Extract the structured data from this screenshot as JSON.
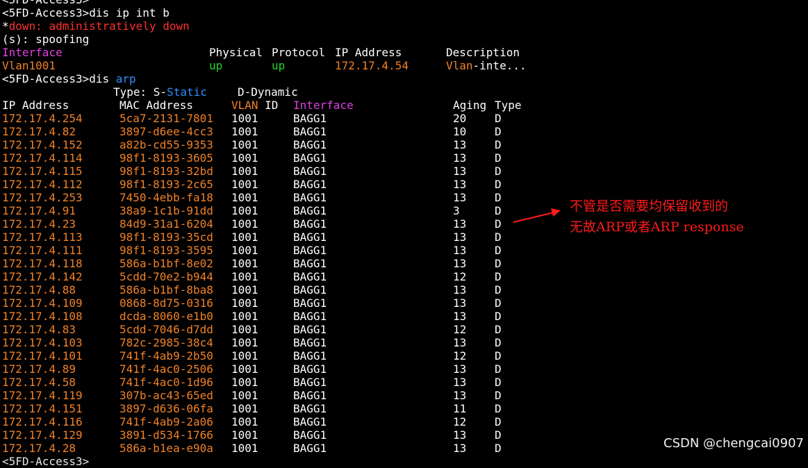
{
  "terminal": {
    "lines_top": [
      "<5FD-Access3>",
      "<5FD-Access3>dis ip int b"
    ],
    "down_star": "*",
    "down_word": "down",
    "down_rest": ": administratively down",
    "spoofing_line": "(s): spoofing",
    "ipint_header": {
      "interface": "Interface",
      "physical": "Physical",
      "protocol": "Protocol",
      "ip": "IP Address",
      "desc": "Description"
    },
    "ipint_row": {
      "interface": "Vlan1001",
      "physical": "up",
      "protocol": "up",
      "ip": "172.17.4.54",
      "desc_vlan": "Vlan",
      "desc_rest": "-inte..."
    },
    "arp_cmd_prefix": "<5FD-Access3>dis ",
    "arp_cmd_word": "arp",
    "type_label": "Type: ",
    "type_s_prefix": "S-",
    "type_s_word": "Static",
    "type_d": "D-Dynamic",
    "arp_header": {
      "ip": "IP Address",
      "mac": "MAC Address",
      "vlan_word": "VLAN",
      "vlan_id": " ID",
      "interface": "Interface",
      "aging": "Aging",
      "type": "Type"
    },
    "arp_rows": [
      {
        "ip": "172.17.4.254",
        "mac": "5ca7-2131-7801",
        "vlan": "1001",
        "iface": "BAGG1",
        "aging": "20",
        "type": "D"
      },
      {
        "ip": "172.17.4.82",
        "mac": "3897-d6ee-4cc3",
        "vlan": "1001",
        "iface": "BAGG1",
        "aging": "10",
        "type": "D"
      },
      {
        "ip": "172.17.4.152",
        "mac": "a82b-cd55-9353",
        "vlan": "1001",
        "iface": "BAGG1",
        "aging": "13",
        "type": "D"
      },
      {
        "ip": "172.17.4.114",
        "mac": "98f1-8193-3605",
        "vlan": "1001",
        "iface": "BAGG1",
        "aging": "13",
        "type": "D"
      },
      {
        "ip": "172.17.4.115",
        "mac": "98f1-8193-32bd",
        "vlan": "1001",
        "iface": "BAGG1",
        "aging": "13",
        "type": "D"
      },
      {
        "ip": "172.17.4.112",
        "mac": "98f1-8193-2c65",
        "vlan": "1001",
        "iface": "BAGG1",
        "aging": "13",
        "type": "D"
      },
      {
        "ip": "172.17.4.253",
        "mac": "7450-4ebb-fa18",
        "vlan": "1001",
        "iface": "BAGG1",
        "aging": "13",
        "type": "D"
      },
      {
        "ip": "172.17.4.91",
        "mac": "38a9-1c1b-91dd",
        "vlan": "1001",
        "iface": "BAGG1",
        "aging": "3",
        "type": "D"
      },
      {
        "ip": "172.17.4.23",
        "mac": "84d9-31a1-6204",
        "vlan": "1001",
        "iface": "BAGG1",
        "aging": "13",
        "type": "D"
      },
      {
        "ip": "172.17.4.113",
        "mac": "98f1-8193-35cd",
        "vlan": "1001",
        "iface": "BAGG1",
        "aging": "13",
        "type": "D"
      },
      {
        "ip": "172.17.4.111",
        "mac": "98f1-8193-3595",
        "vlan": "1001",
        "iface": "BAGG1",
        "aging": "13",
        "type": "D"
      },
      {
        "ip": "172.17.4.118",
        "mac": "586a-b1bf-8e02",
        "vlan": "1001",
        "iface": "BAGG1",
        "aging": "13",
        "type": "D"
      },
      {
        "ip": "172.17.4.142",
        "mac": "5cdd-70e2-b944",
        "vlan": "1001",
        "iface": "BAGG1",
        "aging": "12",
        "type": "D"
      },
      {
        "ip": "172.17.4.88",
        "mac": "586a-b1bf-8ba8",
        "vlan": "1001",
        "iface": "BAGG1",
        "aging": "13",
        "type": "D"
      },
      {
        "ip": "172.17.4.109",
        "mac": "0868-8d75-0316",
        "vlan": "1001",
        "iface": "BAGG1",
        "aging": "13",
        "type": "D"
      },
      {
        "ip": "172.17.4.108",
        "mac": "dcda-8060-e1b0",
        "vlan": "1001",
        "iface": "BAGG1",
        "aging": "13",
        "type": "D"
      },
      {
        "ip": "172.17.4.83",
        "mac": "5cdd-7046-d7dd",
        "vlan": "1001",
        "iface": "BAGG1",
        "aging": "12",
        "type": "D"
      },
      {
        "ip": "172.17.4.103",
        "mac": "782c-2985-38c4",
        "vlan": "1001",
        "iface": "BAGG1",
        "aging": "13",
        "type": "D"
      },
      {
        "ip": "172.17.4.101",
        "mac": "741f-4ab9-2b50",
        "vlan": "1001",
        "iface": "BAGG1",
        "aging": "12",
        "type": "D"
      },
      {
        "ip": "172.17.4.89",
        "mac": "741f-4ac0-2506",
        "vlan": "1001",
        "iface": "BAGG1",
        "aging": "13",
        "type": "D"
      },
      {
        "ip": "172.17.4.58",
        "mac": "741f-4ac0-1d96",
        "vlan": "1001",
        "iface": "BAGG1",
        "aging": "13",
        "type": "D"
      },
      {
        "ip": "172.17.4.119",
        "mac": "307b-ac43-65ed",
        "vlan": "1001",
        "iface": "BAGG1",
        "aging": "13",
        "type": "D"
      },
      {
        "ip": "172.17.4.151",
        "mac": "3897-d636-06fa",
        "vlan": "1001",
        "iface": "BAGG1",
        "aging": "11",
        "type": "D"
      },
      {
        "ip": "172.17.4.116",
        "mac": "741f-4ab9-2a06",
        "vlan": "1001",
        "iface": "BAGG1",
        "aging": "12",
        "type": "D"
      },
      {
        "ip": "172.17.4.129",
        "mac": "3891-d534-1766",
        "vlan": "1001",
        "iface": "BAGG1",
        "aging": "13",
        "type": "D"
      },
      {
        "ip": "172.17.4.28",
        "mac": "586a-b1ea-e90a",
        "vlan": "1001",
        "iface": "BAGG1",
        "aging": "13",
        "type": "D"
      }
    ],
    "last_prompt": "<5FD-Access3>"
  },
  "annotation": {
    "line1": "不管是否需要均保留收到的",
    "line2": "无故ARP或者ARP response",
    "color": "#ff1a1a"
  },
  "watermark": "CSDN @chengcai0907",
  "colors": {
    "background": "#000000",
    "text": "#ffffff",
    "orange": "#f08228",
    "green": "#28d228",
    "red": "#ff3030",
    "magenta": "#e040e0",
    "blue": "#2f8fff"
  }
}
